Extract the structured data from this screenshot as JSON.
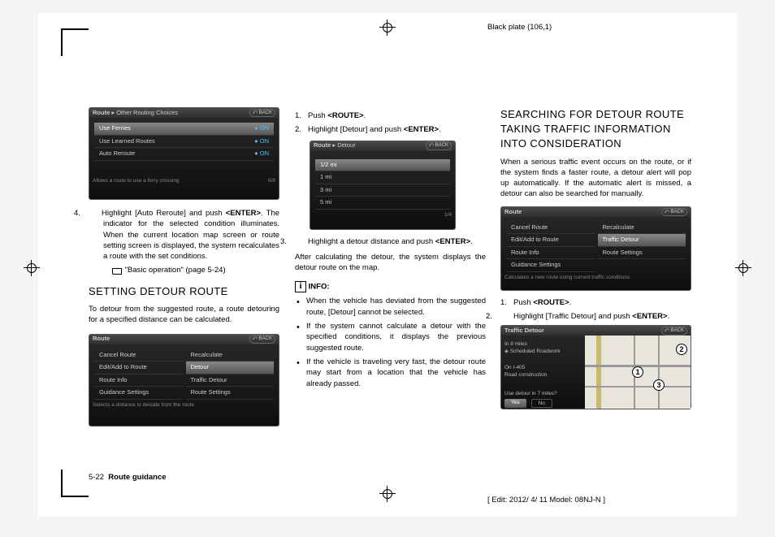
{
  "plate_label": "Black plate (106,1)",
  "edit_label": "[ Edit: 2012/ 4/ 11  Model: 08NJ-N ]",
  "footer": {
    "page": "5-22",
    "section": "Route guidance"
  },
  "col1": {
    "shot1": {
      "hdr": "Route",
      "hdr2": "Other Routing Choices",
      "back": "BACK",
      "rows": [
        [
          "Use Ferries",
          "ON"
        ],
        [
          "Use Learned Routes",
          "ON"
        ],
        [
          "Auto Reroute",
          "ON"
        ]
      ],
      "ftr": "Allows a route to use a ferry crossing",
      "pager": "6/8"
    },
    "step4": {
      "n": "4.",
      "t": "Highlight [Auto Reroute] and push <ENTER>. The indicator for the selected condition illuminates. When the current location map screen or route setting screen is displayed, the system recalculates a route with the set conditions."
    },
    "ref": "\"Basic operation\" (page 5-24)",
    "h1": "SETTING DETOUR ROUTE",
    "intro": "To detour from the suggested route, a route detouring for a specified distance can be calculated.",
    "shot2": {
      "hdr": "Route",
      "back": "BACK",
      "left": [
        "Cancel Route",
        "Edit/Add to Route",
        "Route Info",
        "Guidance Settings"
      ],
      "right": [
        "Recalculate",
        "Detour",
        "Traffic Detour",
        "Route Settings"
      ],
      "sel": "Detour",
      "ftr": "Selects a distance to deviate from the route"
    }
  },
  "col2": {
    "s1": {
      "n": "1.",
      "t": "Push <ROUTE>."
    },
    "s2": {
      "n": "2.",
      "t": "Highlight [Detour] and push <ENTER>."
    },
    "shot": {
      "hdr": "Route",
      "hdr2": "Detour",
      "back": "BACK",
      "rows": [
        "1/2 mi",
        "1 mi",
        "3 mi",
        "5 mi"
      ],
      "sel": "1/2 mi",
      "pager": "1/4"
    },
    "s3": {
      "n": "3.",
      "t": "Highlight a detour distance and push <ENTER>."
    },
    "after": "After calculating the detour, the system displays the detour route on the map.",
    "info": "INFO:",
    "b1": "When the vehicle has deviated from the suggested route, [Detour] cannot be selected.",
    "b2": "If the system cannot calculate a detour with the specified conditions, it displays the previous suggested route.",
    "b3": "If the vehicle is traveling very fast, the detour route may start from a location that the vehicle has already passed."
  },
  "col3": {
    "h1": "SEARCHING FOR DETOUR ROUTE TAKING TRAFFIC INFORMATION INTO CONSIDERATION",
    "intro": "When a serious traffic event occurs on the route, or if the system finds a faster route, a detour alert will pop up automatically. If the automatic alert is missed, a detour can also be searched for manually.",
    "shot1": {
      "hdr": "Route",
      "back": "BACK",
      "left": [
        "Cancel Route",
        "Edit/Add to Route",
        "Route Info",
        "Guidance Settings"
      ],
      "right": [
        "Recalculate",
        "Traffic Detour",
        "Route Settings"
      ],
      "sel": "Traffic Detour",
      "ftr": "Calculates a new route using current traffic conditions"
    },
    "s1": {
      "n": "1.",
      "t": "Push <ROUTE>."
    },
    "s2": {
      "n": "2.",
      "t": "Highlight [Traffic Detour] and push <ENTER>."
    },
    "shot2": {
      "hdr": "Traffic Detour",
      "back": "BACK",
      "l1": "In 8 miles",
      "l2": "Scheduled Roadwork",
      "l3": "On I-405",
      "l4": "Road construction",
      "q": "Use detour in 7 miles?",
      "yes": "Yes",
      "no": "No"
    },
    "m": {
      "a": "1",
      "b": "2",
      "c": "3"
    }
  }
}
